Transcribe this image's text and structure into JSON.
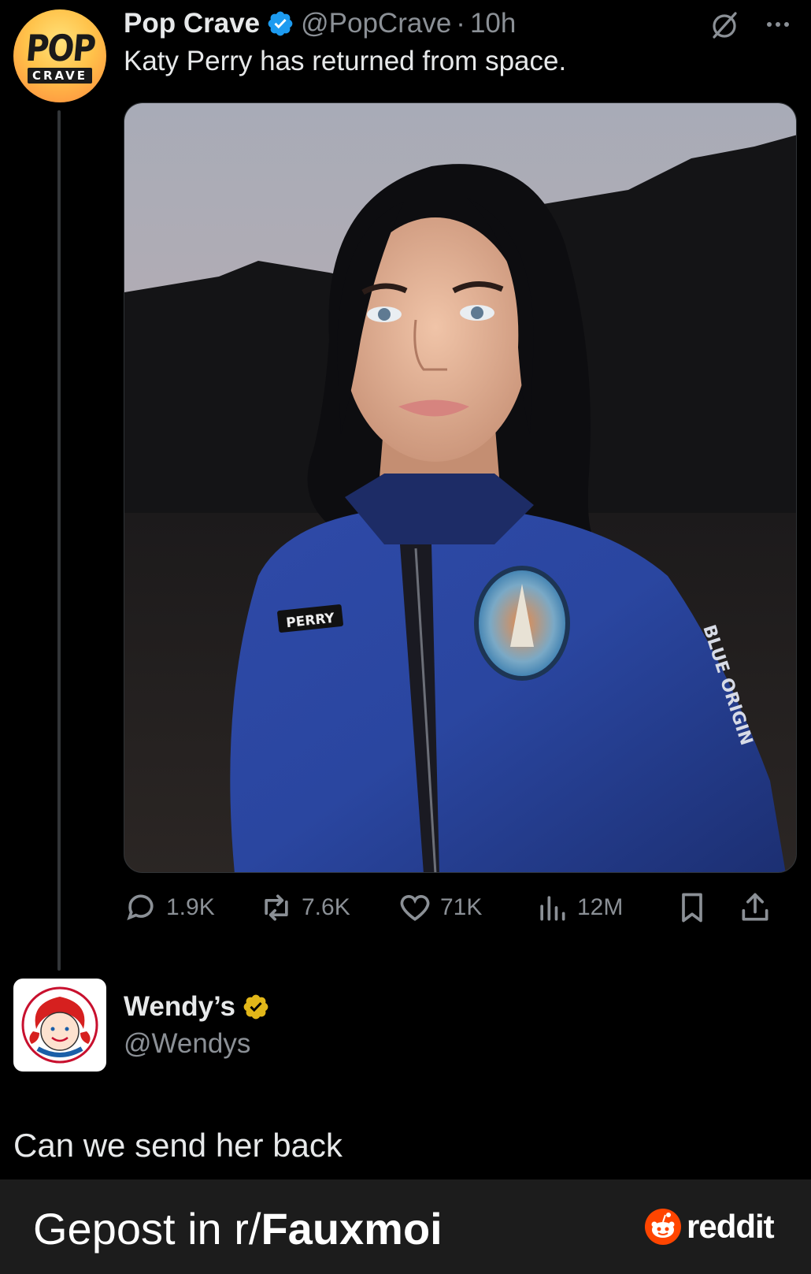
{
  "tweet": {
    "author_name": "Pop Crave",
    "handle": "@PopCrave",
    "separator": "·",
    "time": "10h",
    "text": "Katy Perry has returned from space.",
    "avatar": {
      "top": "POP",
      "bottom": "CRAVE"
    },
    "media": {
      "patch_label": "PERRY",
      "sleeve_text": "BLUE ORIGIN"
    },
    "actions": {
      "replies": "1.9K",
      "reposts": "7.6K",
      "likes": "71K",
      "views": "12M"
    },
    "icons": [
      "verified-badge-icon",
      "grok-icon",
      "more-icon",
      "reply-icon",
      "repost-icon",
      "like-icon",
      "views-icon",
      "bookmark-icon",
      "share-icon"
    ],
    "verified_color": "#1d9bf0"
  },
  "reply": {
    "author_name": "Wendy’s",
    "handle": "@Wendys",
    "text": "Can we send her back",
    "verified_color": "#e2b719"
  },
  "footer": {
    "prefix": "Gepost in r/",
    "subreddit": "Fauxmoi",
    "brand": "reddit",
    "brand_color": "#ff4500"
  }
}
